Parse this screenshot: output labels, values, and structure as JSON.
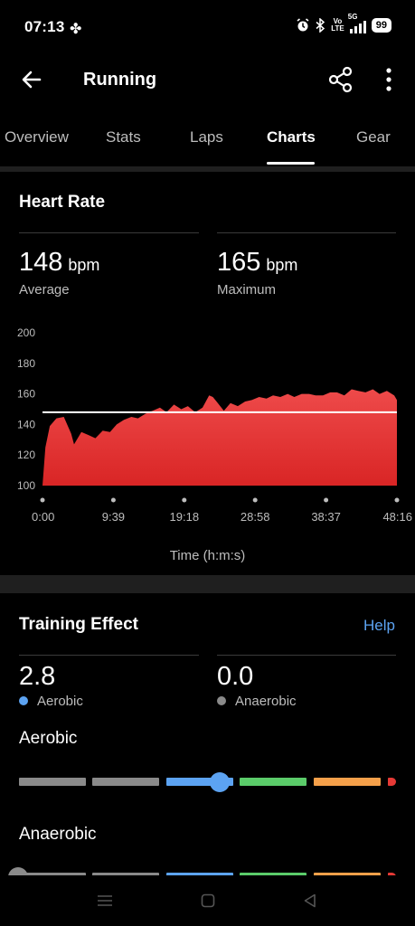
{
  "status_bar": {
    "time": "07:13",
    "network_label_top": "Vo",
    "network_label_bottom": "LTE",
    "network_type": "5G",
    "battery": "99",
    "icons": [
      "fan-icon",
      "alarm-icon",
      "bluetooth-icon",
      "signal-icon",
      "battery-icon"
    ]
  },
  "app_bar": {
    "title": "Running",
    "icons": [
      "back-arrow-icon",
      "share-icon",
      "more-vert-icon"
    ]
  },
  "tabs": [
    {
      "label": "Overview",
      "active": false
    },
    {
      "label": "Stats",
      "active": false
    },
    {
      "label": "Laps",
      "active": false
    },
    {
      "label": "Charts",
      "active": true
    },
    {
      "label": "Gear",
      "active": false
    }
  ],
  "heart_rate": {
    "title": "Heart Rate",
    "average": {
      "value": "148",
      "unit": "bpm",
      "label": "Average"
    },
    "maximum": {
      "value": "165",
      "unit": "bpm",
      "label": "Maximum"
    },
    "x_axis_title": "Time (h:m:s)"
  },
  "chart_data": {
    "type": "area",
    "title": "",
    "xlabel": "Time (h:m:s)",
    "ylabel": "",
    "y_ticks": [
      "200",
      "180",
      "160",
      "140",
      "120",
      "100"
    ],
    "x_ticks": [
      "0:00",
      "9:39",
      "19:18",
      "28:58",
      "38:37",
      "48:16"
    ],
    "ylim": [
      100,
      200
    ],
    "grid": false,
    "fill_color": "#e53935",
    "average_line": 148,
    "average_line_color": "#ffffff",
    "series": [
      {
        "x": [
          0,
          0.4,
          1,
          1.9,
          2.9,
          3.9,
          4.3,
          5.3,
          6.3,
          7.2,
          8.2,
          9.2,
          10.1,
          11.1,
          12.1,
          13,
          14,
          15,
          16,
          16.9,
          17.9,
          18.9,
          19.8,
          20.8,
          21.8,
          22.7,
          23.2,
          23.7,
          24.7,
          25.6,
          26.6,
          27.6,
          28.5,
          29.5,
          30.5,
          31.4,
          32.4,
          33.4,
          34.3,
          35.3,
          36.3,
          37.2,
          38.2,
          39.2,
          40.1,
          41.1,
          42.1,
          43,
          44,
          45,
          45.9,
          46.9,
          47.9,
          48.27
        ],
        "values": [
          100,
          125,
          139,
          144,
          145,
          134,
          127,
          135,
          133,
          131,
          136,
          135,
          140,
          143,
          145,
          144,
          147,
          149,
          151,
          148,
          153,
          150,
          152,
          148,
          151,
          159,
          158,
          155,
          149,
          154,
          152,
          155,
          156,
          158,
          157,
          159,
          158,
          160,
          158,
          160,
          160,
          159,
          159,
          161,
          161,
          159,
          163,
          162,
          161,
          163,
          160,
          162,
          159,
          156
        ]
      }
    ]
  },
  "training_effect": {
    "title": "Training Effect",
    "help_label": "Help",
    "aerobic_value": "2.8",
    "aerobic_label": "Aerobic",
    "anaerobic_value": "0.0",
    "anaerobic_label": "Anaerobic",
    "aerobic_section_label": "Aerobic",
    "anaerobic_section_label": "Anaerobic",
    "aerobic_color": "#5ca3f2",
    "anaerobic_color": "#8a8a8a",
    "aerobic_level": 2.8,
    "anaerobic_level": 0.0,
    "scale_colors": [
      "#8a8a8a",
      "#8a8a8a",
      "#5ca3f2",
      "#5bcc6a",
      "#f5a04a",
      "#e53935"
    ]
  },
  "nav_bar": {
    "icons": [
      "recents-icon",
      "home-icon",
      "back-icon"
    ]
  }
}
